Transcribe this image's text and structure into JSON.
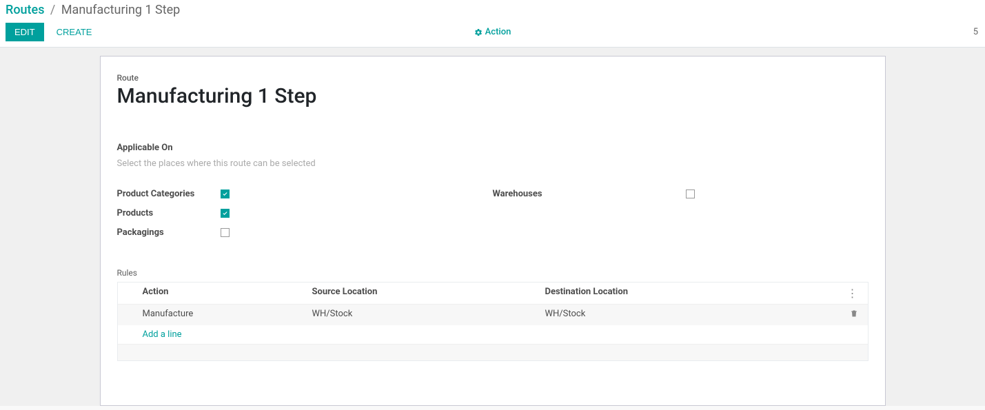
{
  "breadcrumb": {
    "root": "Routes",
    "sep": "/",
    "current": "Manufacturing 1 Step"
  },
  "toolbar": {
    "edit": "EDIT",
    "create": "CREATE",
    "action": "Action"
  },
  "pager": {
    "text": "5"
  },
  "form": {
    "route_label": "Route",
    "route_name": "Manufacturing 1 Step",
    "applicable_on_label": "Applicable On",
    "applicable_on_desc": "Select the places where this route can be selected",
    "fields": {
      "product_categories": {
        "label": "Product Categories",
        "checked": true
      },
      "products": {
        "label": "Products",
        "checked": true
      },
      "packagings": {
        "label": "Packagings",
        "checked": false
      },
      "warehouses": {
        "label": "Warehouses",
        "checked": false
      }
    },
    "rules": {
      "label": "Rules",
      "headers": {
        "action": "Action",
        "source": "Source Location",
        "destination": "Destination Location"
      },
      "rows": [
        {
          "action": "Manufacture",
          "source": "WH/Stock",
          "destination": "WH/Stock"
        }
      ],
      "add_line": "Add a line"
    }
  }
}
